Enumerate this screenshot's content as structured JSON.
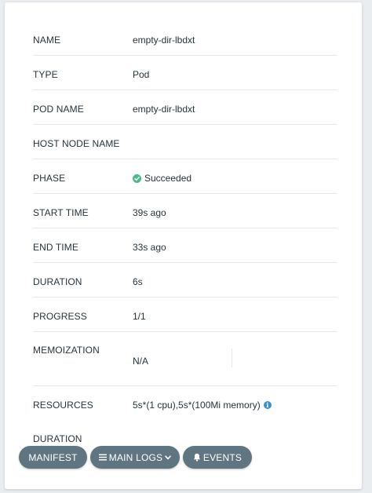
{
  "colors": {
    "success": "#4cb98a",
    "info": "#3b91c6",
    "button": "#5f7682"
  },
  "details": {
    "name": {
      "label": "NAME",
      "value": "empty-dir-lbdxt"
    },
    "type": {
      "label": "TYPE",
      "value": "Pod"
    },
    "pod_name": {
      "label": "POD NAME",
      "value": "empty-dir-lbdxt"
    },
    "host_node_name": {
      "label": "HOST NODE NAME",
      "value": ""
    },
    "phase": {
      "label": "PHASE",
      "value": "Succeeded",
      "icon": "check-circle-icon"
    },
    "start_time": {
      "label": "START TIME",
      "value": "39s ago"
    },
    "end_time": {
      "label": "END TIME",
      "value": "33s ago"
    },
    "duration": {
      "label": "DURATION",
      "value": "6s"
    },
    "progress": {
      "label": "PROGRESS",
      "value": "1/1"
    },
    "memoization": {
      "label": "MEMOIZATION",
      "value": "N/A"
    },
    "resources": {
      "label": "RESOURCES",
      "value": "5s*(1 cpu),5s*(100Mi memory)",
      "icon": "info-icon"
    },
    "resources_duration": {
      "label": "DURATION",
      "value": ""
    }
  },
  "actions": {
    "manifest": {
      "label": "MANIFEST"
    },
    "main_logs": {
      "label": "MAIN LOGS",
      "icon": "list-icon",
      "trailing_icon": "caret-down-icon"
    },
    "events": {
      "label": "EVENTS",
      "icon": "bell-icon"
    }
  }
}
